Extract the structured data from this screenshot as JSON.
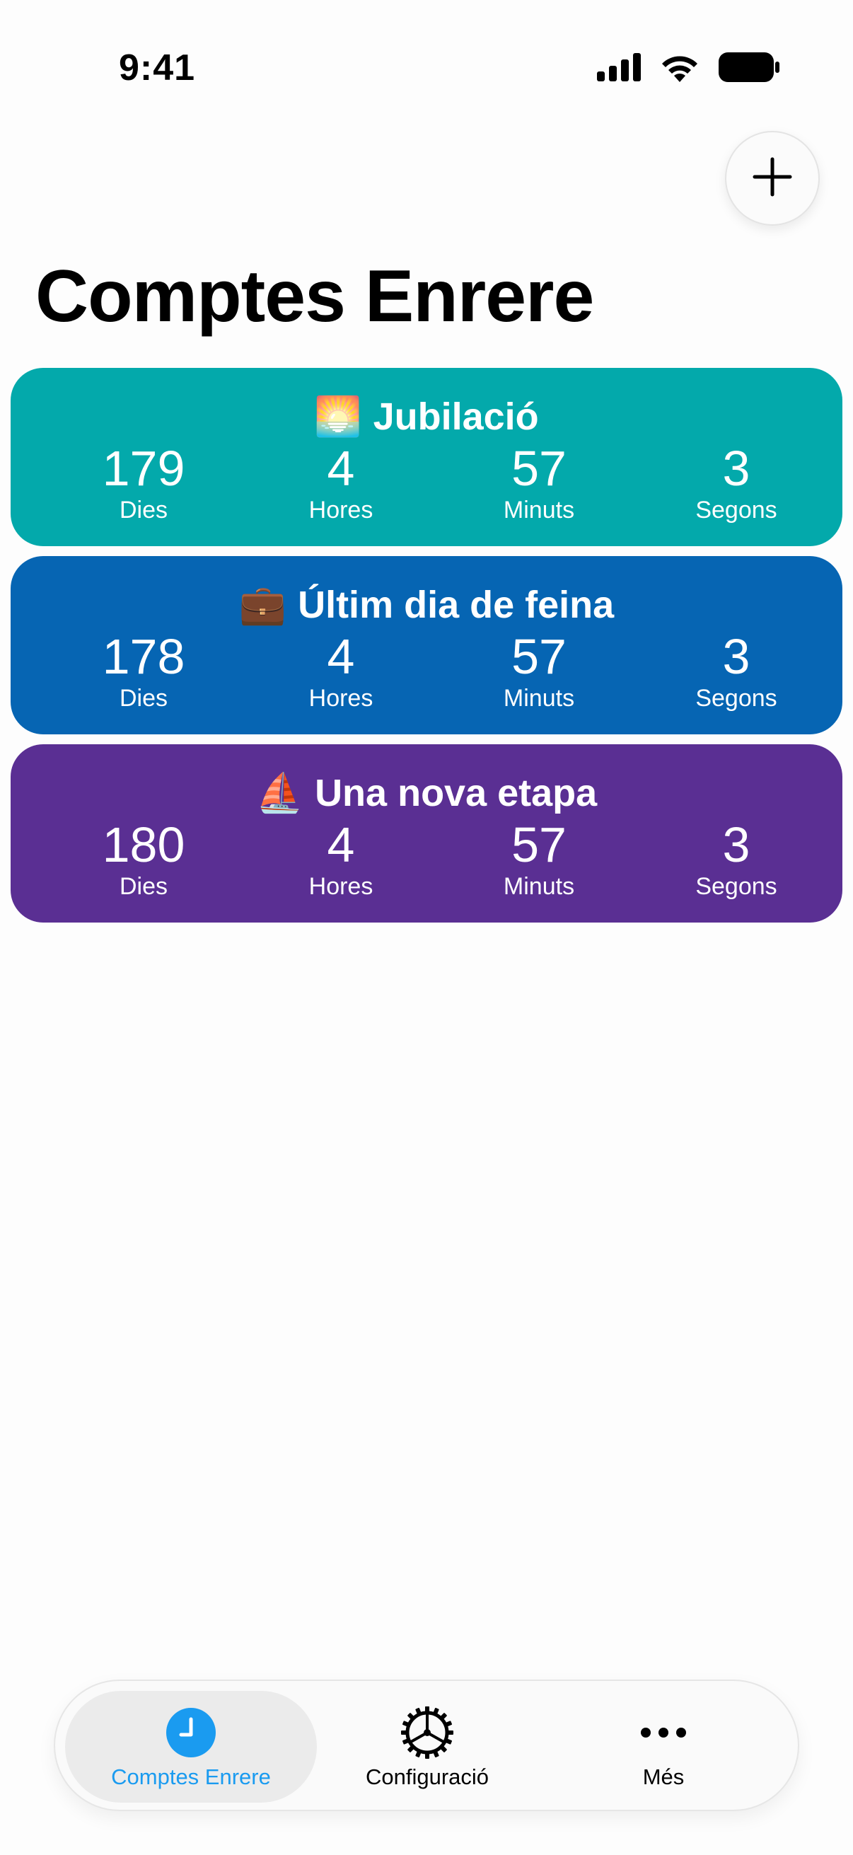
{
  "status_bar": {
    "time": "9:41"
  },
  "page": {
    "title": "Comptes Enrere"
  },
  "countdowns": [
    {
      "emoji": "🌅",
      "title": "Jubilació",
      "color": "#03A9AB",
      "values": [
        "179",
        "4",
        "57",
        "3"
      ],
      "labels": [
        "Dies",
        "Hores",
        "Minuts",
        "Segons"
      ]
    },
    {
      "emoji": "💼",
      "title": "Últim dia de feina",
      "color": "#0665B3",
      "values": [
        "178",
        "4",
        "57",
        "3"
      ],
      "labels": [
        "Dies",
        "Hores",
        "Minuts",
        "Segons"
      ]
    },
    {
      "emoji": "⛵",
      "title": "Una nova etapa",
      "color": "#5A2F93",
      "values": [
        "180",
        "4",
        "57",
        "3"
      ],
      "labels": [
        "Dies",
        "Hores",
        "Minuts",
        "Segons"
      ]
    }
  ],
  "tab_bar": {
    "tabs": [
      {
        "label": "Comptes Enrere",
        "icon": "clock-icon",
        "active": true
      },
      {
        "label": "Configuració",
        "icon": "gear-icon",
        "active": false
      },
      {
        "label": "Més",
        "icon": "ellipsis-icon",
        "active": false
      }
    ],
    "accent_color": "#1A9BF0"
  }
}
